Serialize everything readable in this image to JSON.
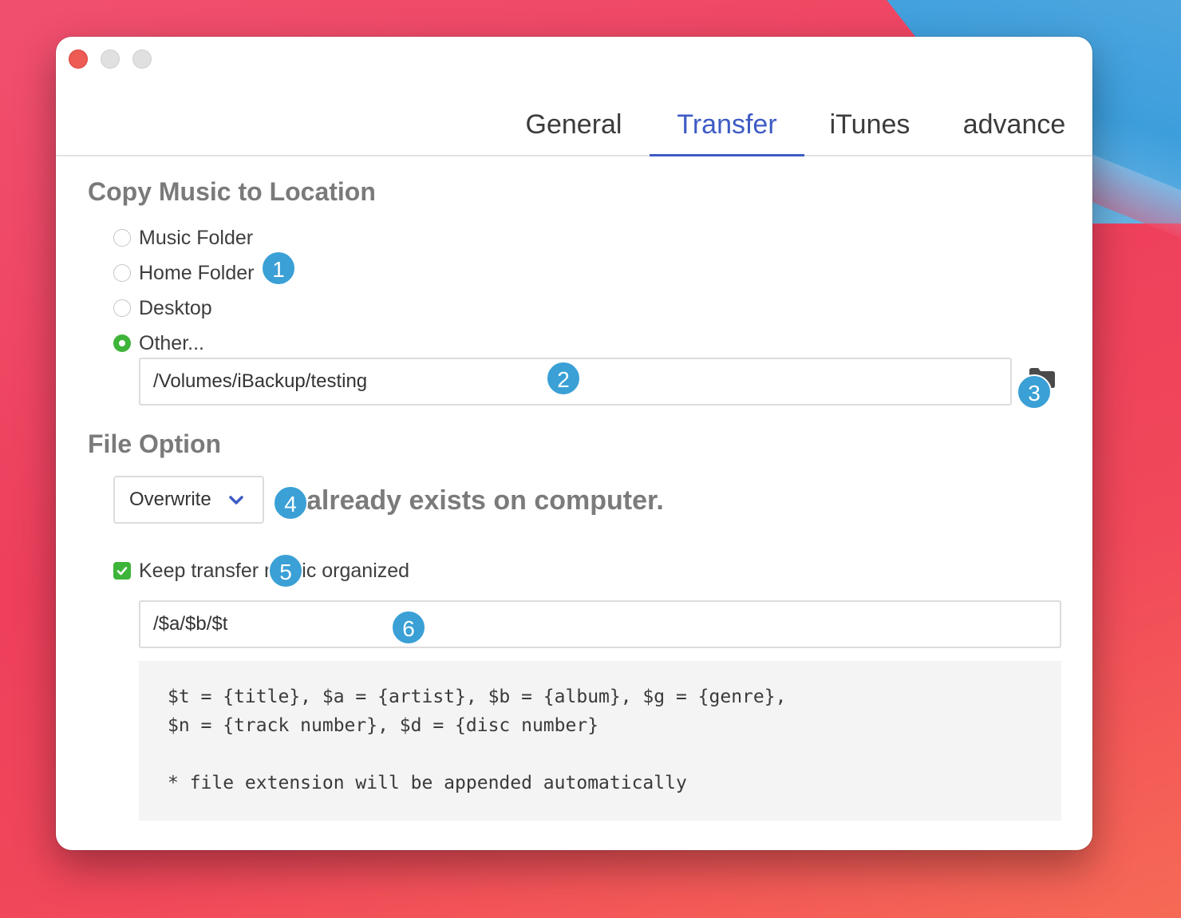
{
  "tabs": [
    {
      "label": "General",
      "active": false
    },
    {
      "label": "Transfer",
      "active": true
    },
    {
      "label": "iTunes",
      "active": false
    },
    {
      "label": "advance",
      "active": false
    }
  ],
  "location": {
    "title": "Copy Music to Location",
    "options": [
      "Music Folder",
      "Home Folder",
      "Desktop",
      "Other..."
    ],
    "selected": "Other...",
    "path_value": "/Volumes/iBackup/testing",
    "browse_icon": "folder-icon"
  },
  "file_option": {
    "title": "File Option",
    "action_value": "Overwrite",
    "action_suffix": "already exists on computer.",
    "organize_label": "Keep transfer music organized",
    "organize_checked": true,
    "pattern_value": "/$a/$b/$t",
    "help_lines": [
      "$t = {title}, $a = {artist}, $b = {album}, $g = {genre},",
      "$n = {track number}, $d = {disc number}",
      "* file extension will be appended automatically"
    ]
  },
  "badges": [
    "1",
    "2",
    "3",
    "4",
    "5",
    "6"
  ],
  "colors": {
    "accent": "#3d5bc4",
    "check_green": "#3fb43a",
    "badge_blue": "#3aa0d6",
    "close_red": "#ee5b54"
  }
}
